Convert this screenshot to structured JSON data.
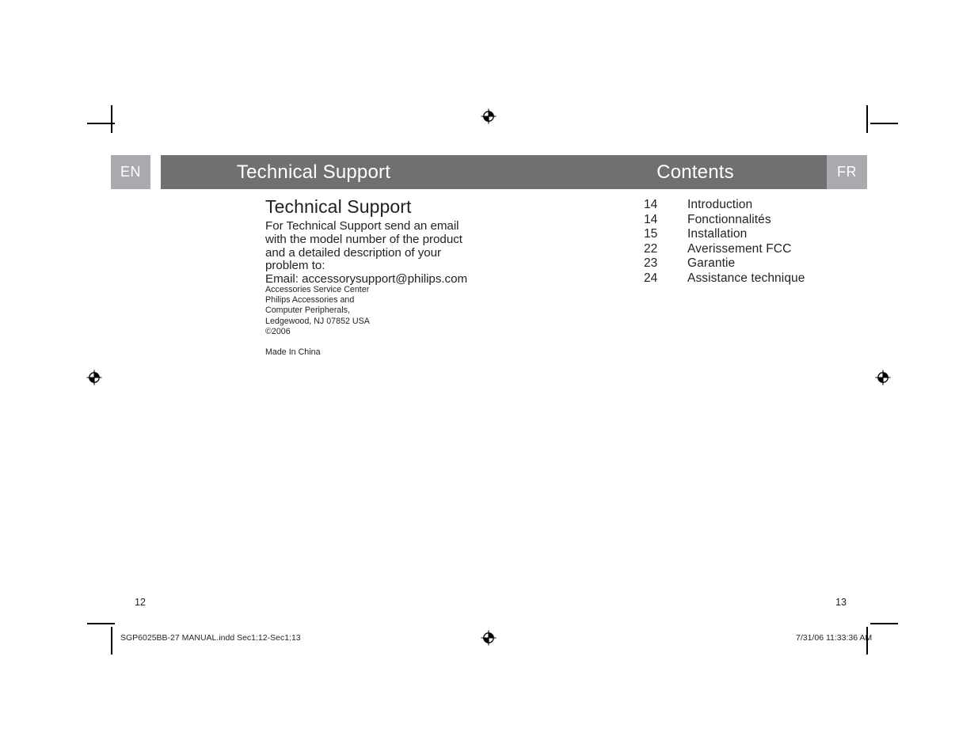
{
  "spread": {
    "left_page": {
      "language_tab": "EN",
      "header_title": "Technical Support",
      "section_heading": "Technical Support",
      "body_paragraph": "For Technical Support send an email with the model number of the product and a detailed description of your problem to:",
      "email_line": "Email: accessorysupport@philips.com",
      "address": [
        "Accessories Service Center",
        "Philips Accessories and",
        "Computer Peripherals,",
        "Ledgewood, NJ  07852 USA",
        "©2006"
      ],
      "origin_line": "Made In China",
      "folio": "12"
    },
    "right_page": {
      "language_tab": "FR",
      "header_title": "Contents",
      "contents": [
        {
          "page": "14",
          "label": "Introduction"
        },
        {
          "page": "14",
          "label": "Fonctionnalités"
        },
        {
          "page": "15",
          "label": "Installation"
        },
        {
          "page": "22",
          "label": "Averissement FCC"
        },
        {
          "page": "23",
          "label": "Garantie"
        },
        {
          "page": "24",
          "label": "Assistance technique"
        }
      ],
      "folio": "13"
    }
  },
  "print_footer": {
    "filename": "SGP6025BB-27 MANUAL.indd   Sec1:12-Sec1:13",
    "timestamp": "7/31/06   11:33:36 AM"
  },
  "colors": {
    "tab_gray": "#a8aaad",
    "bar_gray": "#6e7072",
    "text": "#231f20",
    "paper": "#ffffff"
  },
  "print_marks": {
    "registration_icon": "registration-target-icon",
    "crop_icon": "crop-mark-icon"
  }
}
